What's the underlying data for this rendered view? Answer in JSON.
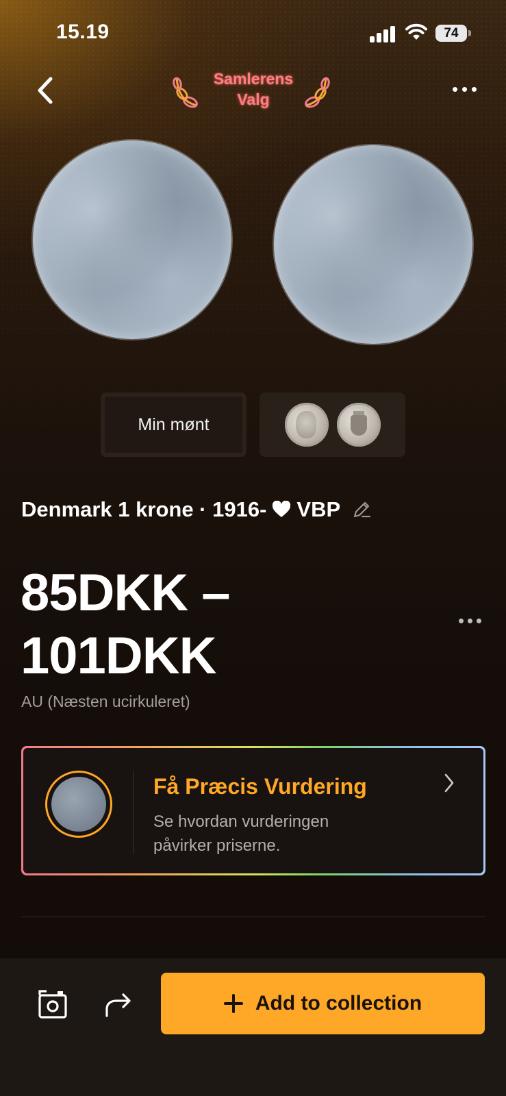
{
  "status_bar": {
    "time": "15.19",
    "battery": "74"
  },
  "header": {
    "badge_line1": "Samlerens",
    "badge_line2": "Valg",
    "back_icon": "chevron-left-icon",
    "more_icon": "more-horizontal-icon"
  },
  "view_toggle": {
    "my_coin_label": "Min mønt",
    "reference_icon": "reference-coins-icon"
  },
  "coin": {
    "title_prefix": "Denmark 1 krone · 1916-",
    "title_suffix": "VBP",
    "price": "85DKK – 101DKK",
    "grade": "AU (Næsten ucirkuleret)"
  },
  "appraisal_card": {
    "title": "Få Præcis Vurdering",
    "subtitle": "Se hvordan vurderingen påvirker priserne."
  },
  "bottom_bar": {
    "add_label": "Add to collection",
    "camera_icon": "camera-icon",
    "share_icon": "share-icon"
  },
  "colors": {
    "accent": "#ffa726",
    "background": "#120b08",
    "badge_text": "#ff7a8a"
  }
}
